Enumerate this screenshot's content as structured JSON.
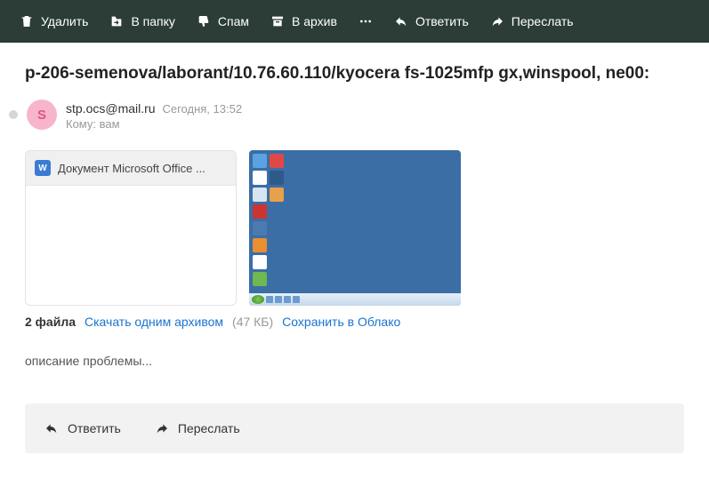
{
  "toolbar": {
    "delete": "Удалить",
    "to_folder": "В папку",
    "spam": "Спам",
    "archive": "В архив",
    "reply": "Ответить",
    "forward": "Переслать"
  },
  "subject": "p-206-semenova/laborant/10.76.60.110/kyocera fs-1025mfp gx,winspool, ne00:",
  "sender": {
    "initial": "S",
    "email": "stp.ocs@mail.ru",
    "date": "Сегодня, 13:52",
    "recipient_label": "Кому:",
    "recipient": "вам"
  },
  "attachments": {
    "cards": [
      {
        "icon_letter": "W",
        "name": "Документ Microsoft Office ..."
      }
    ],
    "count_label": "2 файла",
    "download_label": "Скачать одним архивом",
    "size": "(47 КБ)",
    "save_cloud": "Сохранить в Облако"
  },
  "body": "описание проблемы...",
  "reply_bar": {
    "reply": "Ответить",
    "forward": "Переслать"
  }
}
